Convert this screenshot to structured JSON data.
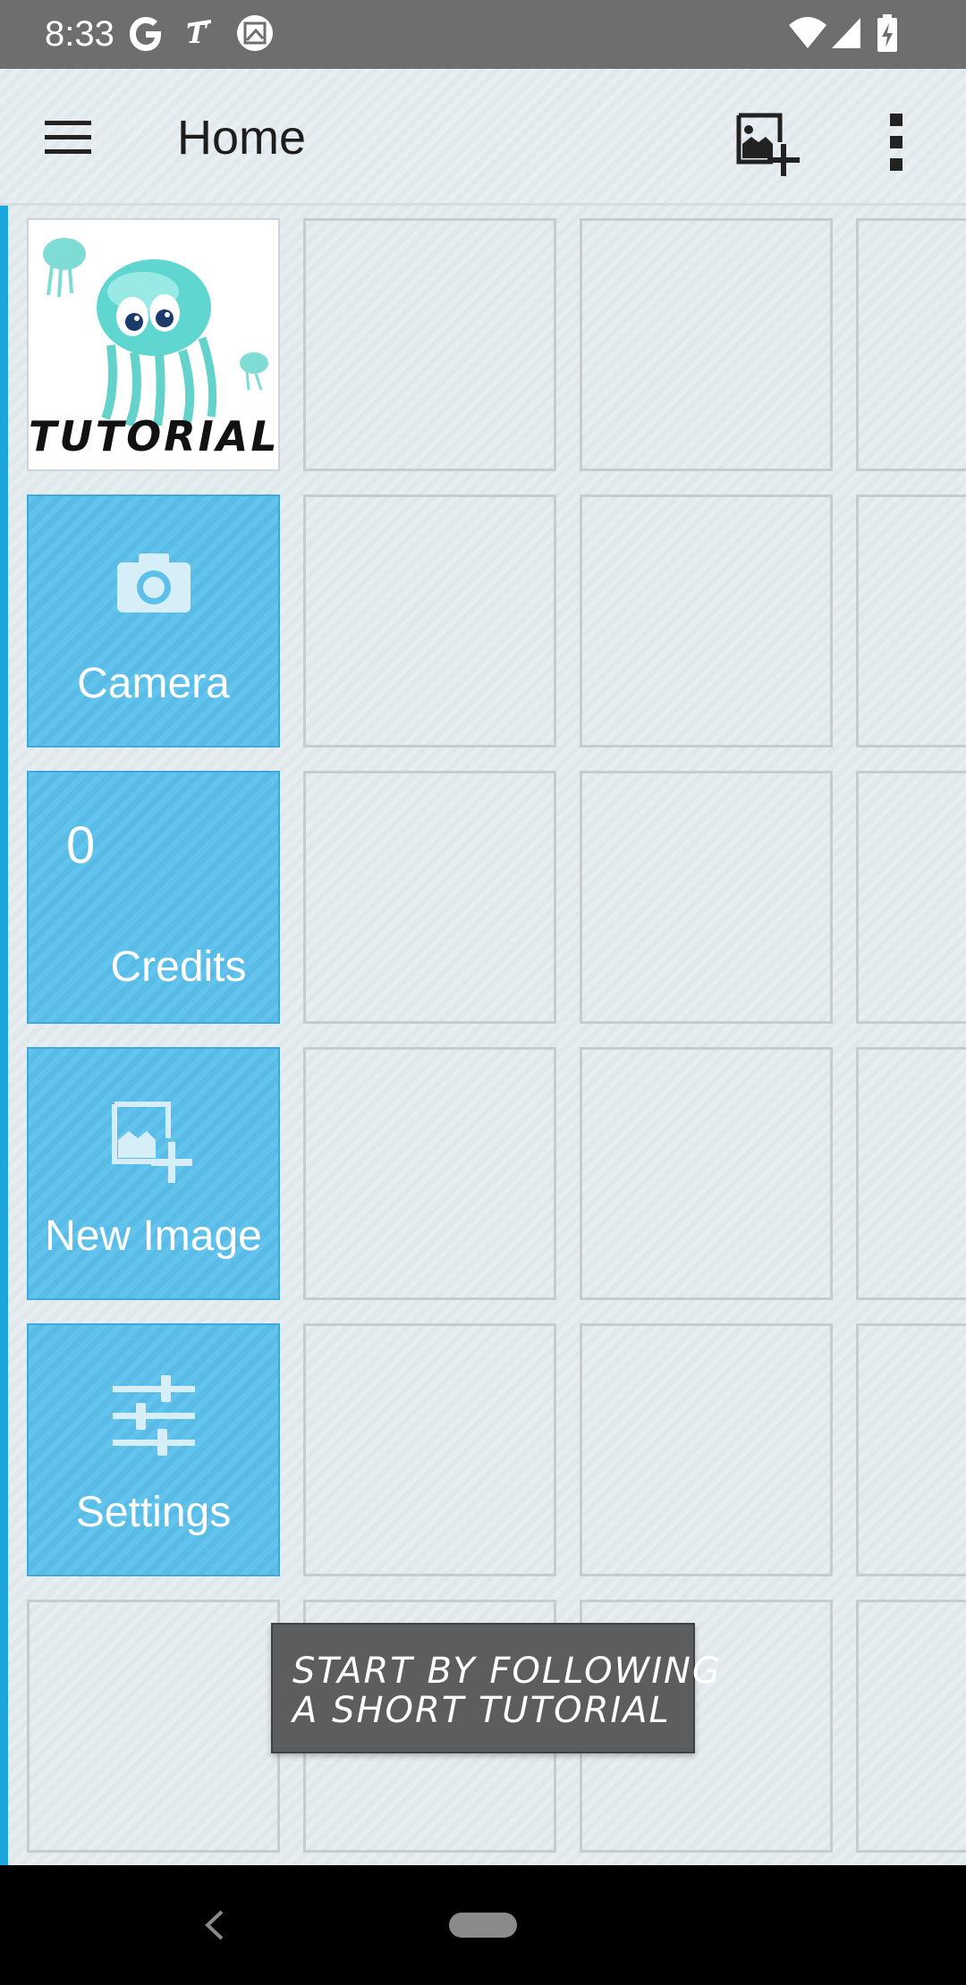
{
  "status_bar": {
    "time": "8:33",
    "icons": [
      "google-icon",
      "translate-icon",
      "image-notification-icon",
      "wifi-icon",
      "signal-icon",
      "battery-charging-icon"
    ]
  },
  "app_bar": {
    "title": "Home",
    "menu_icon": "hamburger-menu-icon",
    "add_image_icon": "add-image-icon",
    "overflow_icon": "more-vertical-icon"
  },
  "tiles": {
    "tutorial": {
      "label": "TUTORIAL",
      "icon": "jellyfish-illustration"
    },
    "camera": {
      "label": "Camera",
      "icon": "camera-icon"
    },
    "credits": {
      "count": "0",
      "label": "Credits"
    },
    "new_image": {
      "label": "New Image",
      "icon": "add-image-icon"
    },
    "settings": {
      "label": "Settings",
      "icon": "sliders-icon"
    }
  },
  "toast": {
    "line1": "START BY FOLLOWING",
    "line2": "A SHORT TUTORIAL"
  },
  "colors": {
    "accent": "#1aa6dd",
    "tile_blue": "#5cc0ea",
    "status_bar": "#6e6e6e",
    "toast_bg": "#5b5d5e"
  }
}
